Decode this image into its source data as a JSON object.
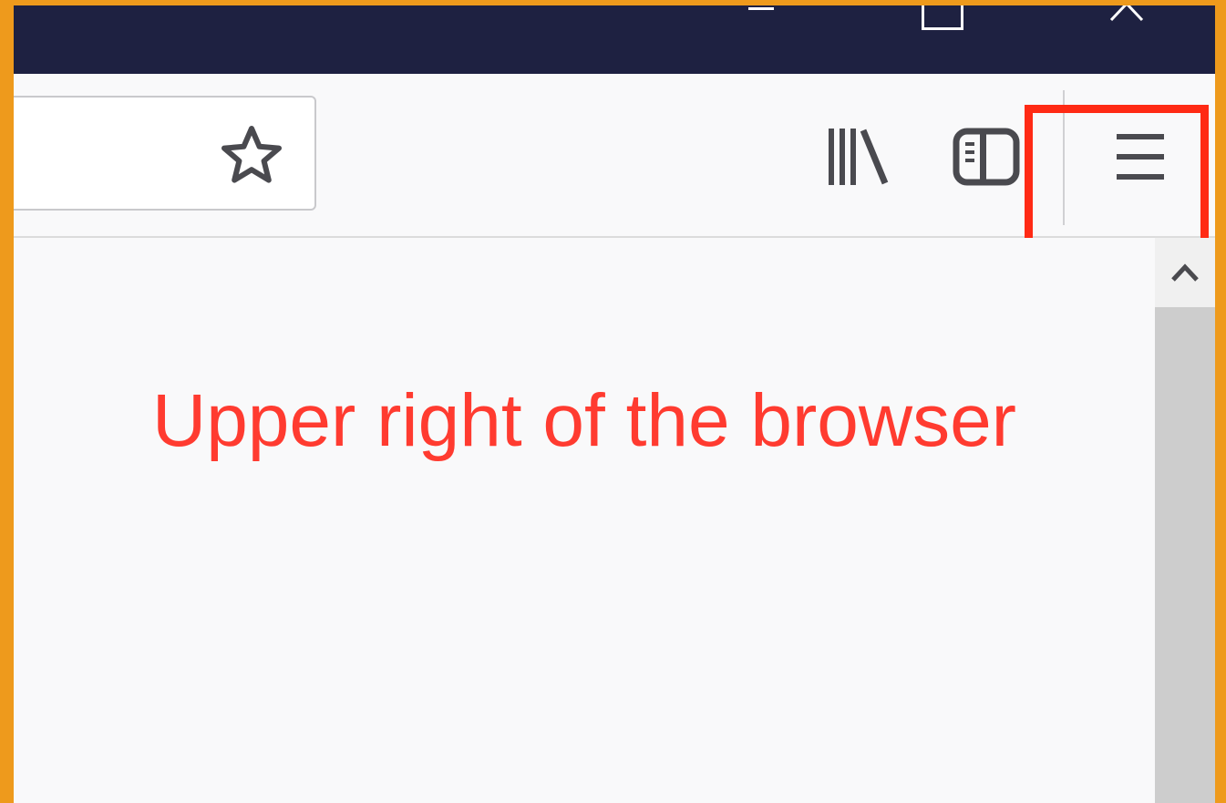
{
  "window": {
    "controls": {
      "minimize_icon": "minimize-icon",
      "maximize_icon": "maximize-icon",
      "close_icon": "close-icon"
    },
    "titlebar_color": "#1e2141"
  },
  "toolbar": {
    "bookmark_icon": "star-icon",
    "library_icon": "library-icon",
    "sidebar_icon": "sidebar-icon",
    "menu_icon": "hamburger-menu-icon"
  },
  "annotation": {
    "caption": "Upper right of the browser",
    "caption_color": "#ff3b30",
    "highlight_color": "#ff2a14",
    "border_color": "#ee9a1c"
  },
  "scrollbar": {
    "up_arrow_icon": "chevron-up-icon"
  }
}
